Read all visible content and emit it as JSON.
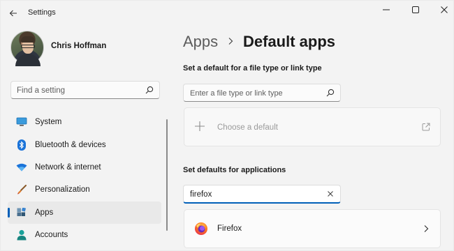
{
  "window": {
    "title": "Settings",
    "back_icon": "back-arrow-icon",
    "controls": [
      "minimize-icon",
      "maximize-icon",
      "close-icon"
    ]
  },
  "profile": {
    "name": "Chris Hoffman"
  },
  "sidebar": {
    "search": {
      "placeholder": "Find a setting",
      "icon": "search-icon"
    },
    "items": [
      {
        "label": "System",
        "icon": "system-monitor-icon",
        "active": false
      },
      {
        "label": "Bluetooth & devices",
        "icon": "bluetooth-icon",
        "active": false
      },
      {
        "label": "Network & internet",
        "icon": "wifi-icon",
        "active": false
      },
      {
        "label": "Personalization",
        "icon": "paintbrush-icon",
        "active": false
      },
      {
        "label": "Apps",
        "icon": "apps-icon",
        "active": true
      },
      {
        "label": "Accounts",
        "icon": "person-icon",
        "active": false
      }
    ]
  },
  "main": {
    "breadcrumb": {
      "parent": "Apps",
      "separator_icon": "chevron-right-icon",
      "current": "Default apps"
    },
    "file_type_section": {
      "label": "Set a default for a file type or link type",
      "search_placeholder": "Enter a file type or link type",
      "choose_default_label": "Choose a default",
      "choose_icon": "plus-icon",
      "open_icon": "open-external-icon"
    },
    "apps_section": {
      "label": "Set defaults for applications",
      "filter_value": "firefox",
      "clear_icon": "clear-x-icon",
      "results": [
        {
          "name": "Firefox",
          "icon": "firefox-icon",
          "chevron": "chevron-right-icon"
        }
      ]
    }
  },
  "colors": {
    "accent": "#005fb8",
    "window_bg": "#f3f3f3"
  }
}
